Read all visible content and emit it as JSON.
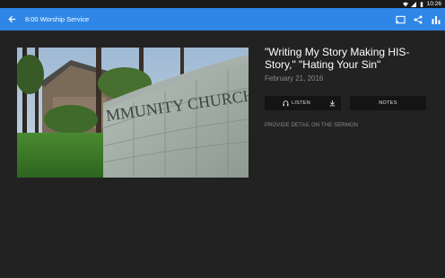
{
  "status_bar": {
    "time": "10:26"
  },
  "app_bar": {
    "title": "8:00 Worship Service",
    "icons": [
      "back-arrow-icon",
      "cast-icon",
      "share-icon",
      "bar-chart-icon"
    ],
    "color": "#2f86e6"
  },
  "hero_image": {
    "sign_text": "MMUNITY CHURCH"
  },
  "sermon": {
    "title": "\"Writing My Story Making HIS-Story,\" \"Hating Your Sin\"",
    "date": "February 21, 2016",
    "listen_label": "LISTEN",
    "notes_label": "NOTES",
    "detail_text": "PROVIDE DETAIL ON THE SERMON"
  }
}
